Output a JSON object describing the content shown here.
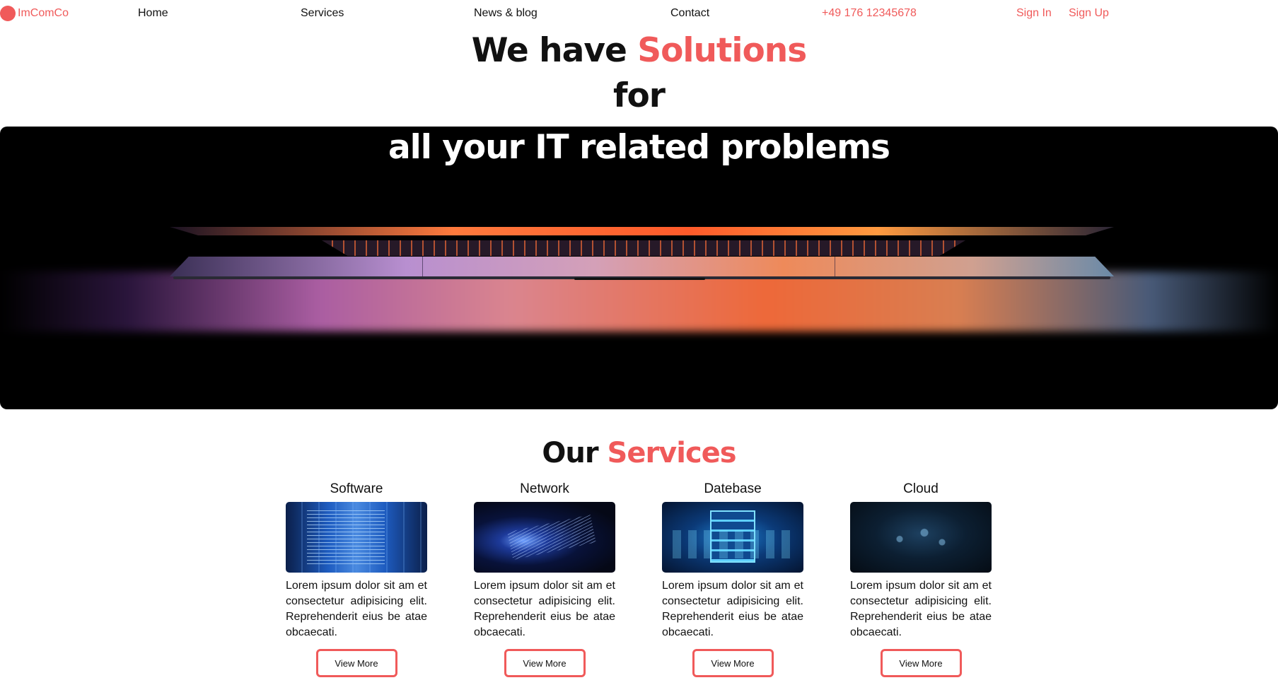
{
  "brand": {
    "name": "ImComCo",
    "accent_color": "#f05a5a"
  },
  "nav": {
    "home": "Home",
    "services": "Services",
    "news": "News & blog",
    "contact": "Contact",
    "phone": "+49 176 12345678",
    "sign_in": "Sign In",
    "sign_up": "Sign Up"
  },
  "hero": {
    "title_part1": "We have ",
    "title_accent": "Solutions",
    "title_line2": "for",
    "title_line3": "all your IT related problems"
  },
  "services": {
    "title_part1": "Our ",
    "title_accent": "Services",
    "cards": [
      {
        "title": "Software",
        "text": "Lorem ipsum dolor sit am et consectetur adipisicing elit. Reprehenderit eius be atae obcaecati.",
        "button": "View More"
      },
      {
        "title": "Network",
        "text": "Lorem ipsum dolor sit am et consectetur adipisicing elit. Reprehenderit eius be atae obcaecati.",
        "button": "View More"
      },
      {
        "title": "Datebase",
        "text": "Lorem ipsum dolor sit am et consectetur adipisicing elit. Reprehenderit eius be atae obcaecati.",
        "button": "View More"
      },
      {
        "title": "Cloud",
        "text": "Lorem ipsum dolor sit am et consectetur adipisicing elit. Reprehenderit eius be atae obcaecati.",
        "button": "View More"
      }
    ]
  }
}
